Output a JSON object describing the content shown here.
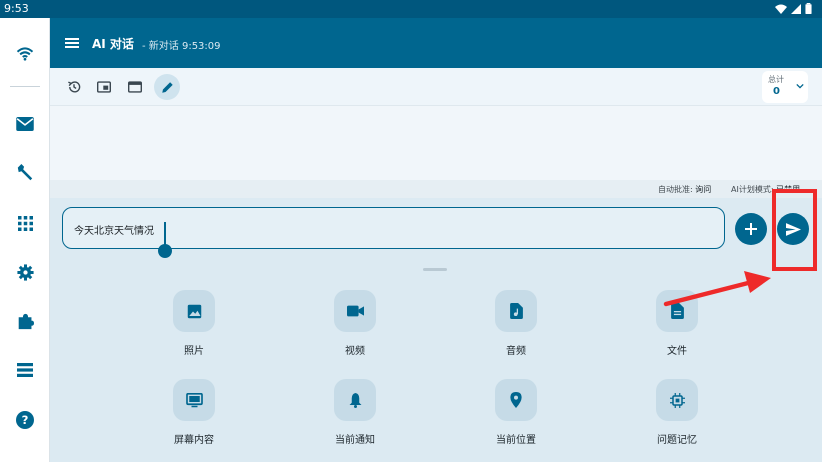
{
  "status": {
    "time": "9:53"
  },
  "rail": {
    "items": [
      "wifi-icon",
      "mail-icon",
      "wrench-icon",
      "apps-grid-icon",
      "settings-gear-icon",
      "puzzle-extension-icon",
      "list-storage-icon",
      "help-icon"
    ]
  },
  "appbar": {
    "title": "AI 对话",
    "subtitle": "- 新对话 9:53:09"
  },
  "toolbar": {
    "total_label": "总计",
    "total_value": "0"
  },
  "meta": {
    "auto_approve_label": "自动批准:",
    "auto_approve_value": "询问",
    "plan_mode_label": "AI计划模式:",
    "plan_mode_value": "已禁用"
  },
  "composer": {
    "input_value": "今天北京天气情况"
  },
  "attachments": [
    {
      "label": "照片",
      "icon": "image-icon"
    },
    {
      "label": "视频",
      "icon": "video-icon"
    },
    {
      "label": "音频",
      "icon": "audio-file-icon"
    },
    {
      "label": "文件",
      "icon": "file-icon"
    },
    {
      "label": "屏幕内容",
      "icon": "screen-content-icon"
    },
    {
      "label": "当前通知",
      "icon": "notification-bell-icon"
    },
    {
      "label": "当前位置",
      "icon": "location-pin-icon"
    },
    {
      "label": "问题记忆",
      "icon": "memory-chip-icon"
    }
  ],
  "colors": {
    "primary": "#00668f",
    "statusbar": "#00577e",
    "annotation": "#ee2a2a"
  }
}
